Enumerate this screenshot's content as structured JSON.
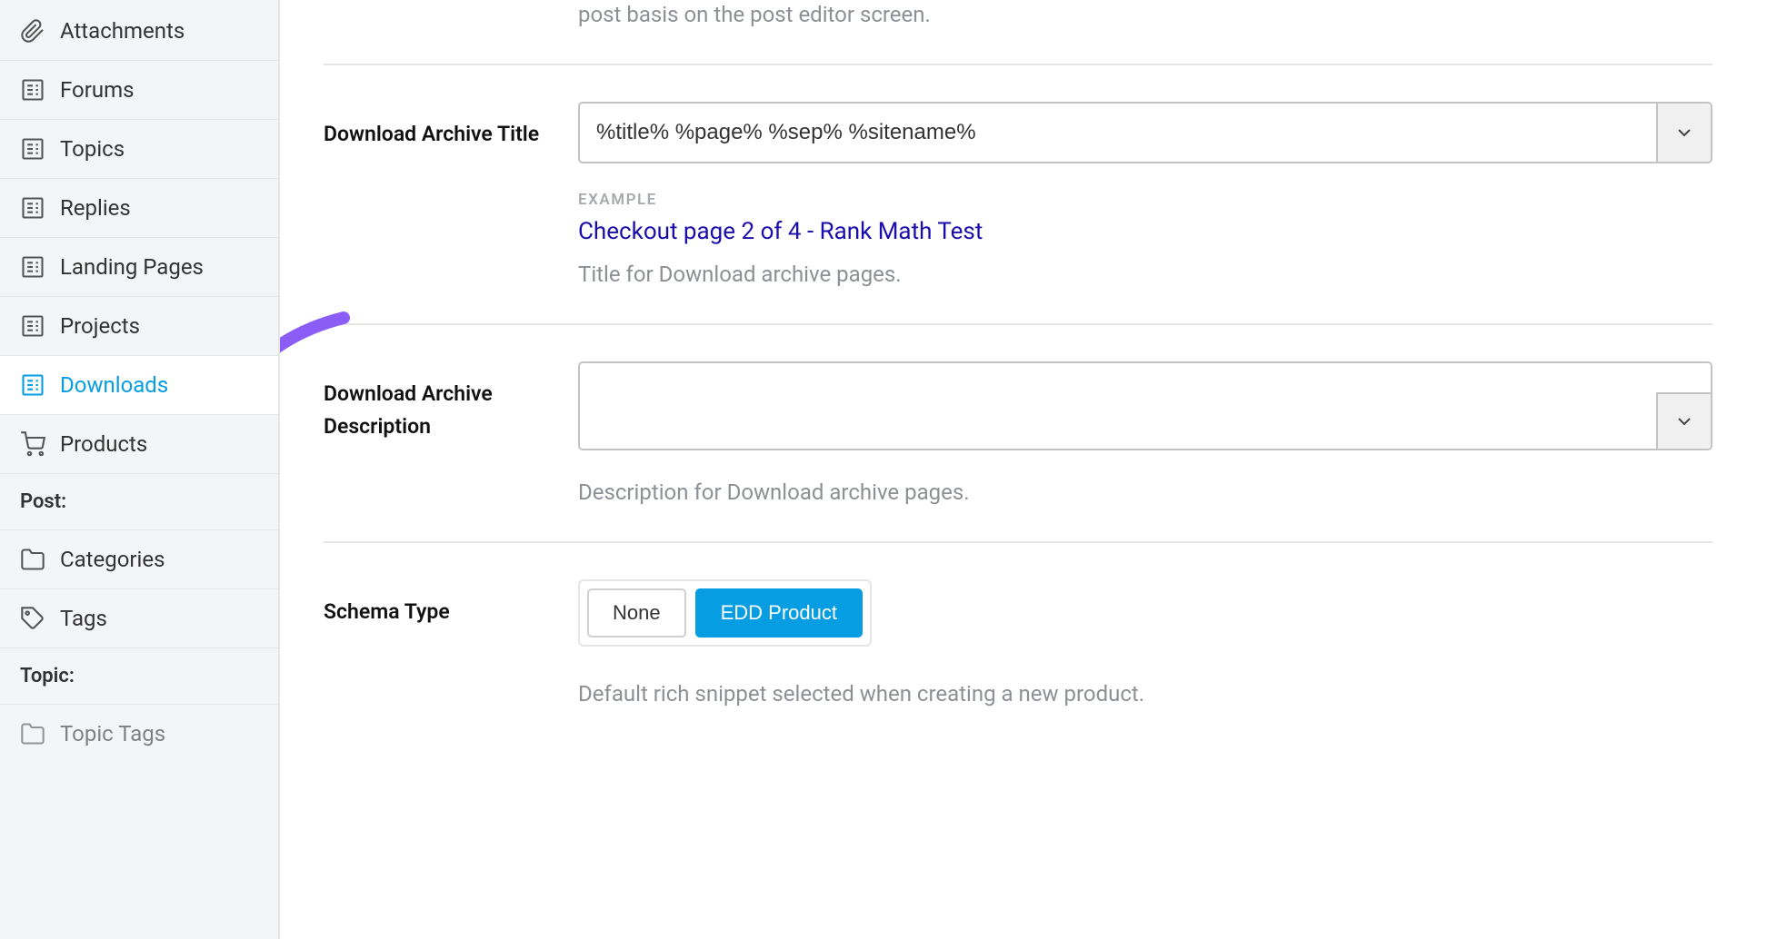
{
  "sidebar": {
    "items": [
      {
        "label": "Attachments",
        "icon": "attachment"
      },
      {
        "label": "Forums",
        "icon": "post"
      },
      {
        "label": "Topics",
        "icon": "post"
      },
      {
        "label": "Replies",
        "icon": "post"
      },
      {
        "label": "Landing Pages",
        "icon": "post"
      },
      {
        "label": "Projects",
        "icon": "post"
      },
      {
        "label": "Downloads",
        "icon": "post",
        "active": true
      },
      {
        "label": "Products",
        "icon": "cart"
      }
    ],
    "group_post": "Post:",
    "post_items": [
      {
        "label": "Categories",
        "icon": "folder"
      },
      {
        "label": "Tags",
        "icon": "tag"
      }
    ],
    "group_topic": "Topic:",
    "topic_items": [
      {
        "label": "Topic Tags",
        "icon": "folder"
      }
    ]
  },
  "main": {
    "intro_text": "post basis on the post editor screen.",
    "archive_title": {
      "label": "Download Archive Title",
      "value": "%title% %page% %sep% %sitename%",
      "example_label": "EXAMPLE",
      "example_value": "Checkout page 2 of 4 - Rank Math Test",
      "help": "Title for Download archive pages."
    },
    "archive_desc": {
      "label": "Download Archive Description",
      "value": "",
      "help": "Description for Download archive pages."
    },
    "schema": {
      "label": "Schema Type",
      "options": [
        "None",
        "EDD Product"
      ],
      "selected": "EDD Product",
      "help": "Default rich snippet selected when creating a new product."
    }
  }
}
